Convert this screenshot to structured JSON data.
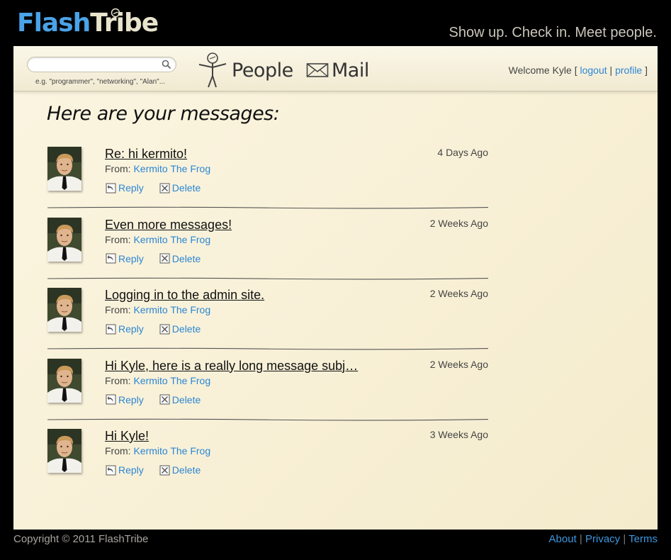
{
  "brand": {
    "logo_part1": "Flash",
    "logo_part2": "Tribe",
    "tagline": "Show up. Check in. Meet people."
  },
  "search": {
    "value": "",
    "placeholder": "",
    "hint": "e.g. \"programmer\", \"networking\", \"Alan\"..."
  },
  "nav": {
    "people_label": "People",
    "mail_label": "Mail"
  },
  "user": {
    "welcome": "Welcome Kyle",
    "open_bracket": "[",
    "logout": "logout",
    "separator": "|",
    "profile": "profile",
    "close_bracket": "]"
  },
  "main": {
    "heading": "Here are your messages:"
  },
  "messages": [
    {
      "subject": "Re: hi kermito!",
      "time": "4 Days Ago",
      "from_label": "From:",
      "sender": "Kermito The Frog",
      "reply": "Reply",
      "delete": "Delete"
    },
    {
      "subject": "Even more messages!",
      "time": "2 Weeks Ago",
      "from_label": "From:",
      "sender": "Kermito The Frog",
      "reply": "Reply",
      "delete": "Delete"
    },
    {
      "subject": "Logging in to the admin site.",
      "time": "2 Weeks Ago",
      "from_label": "From:",
      "sender": "Kermito The Frog",
      "reply": "Reply",
      "delete": "Delete"
    },
    {
      "subject": "Hi Kyle, here is a really long message subj…",
      "time": "2 Weeks Ago",
      "from_label": "From:",
      "sender": "Kermito The Frog",
      "reply": "Reply",
      "delete": "Delete"
    },
    {
      "subject": "Hi Kyle!",
      "time": "3 Weeks Ago",
      "from_label": "From:",
      "sender": "Kermito The Frog",
      "reply": "Reply",
      "delete": "Delete"
    }
  ],
  "footer": {
    "copyright": "Copyright © 2011 FlashTribe",
    "about": "About",
    "sep1": "|",
    "privacy": "Privacy",
    "sep2": "|",
    "terms": "Terms"
  },
  "colors": {
    "link": "#2b86d3",
    "logo_blue": "#4aa3e8",
    "page_bg": "#f8f0d6",
    "frame_bg": "#000000"
  },
  "icons": {
    "search": "search-icon",
    "people": "people-stick-figure-icon",
    "mail": "mail-envelope-icon",
    "reply": "reply-icon",
    "delete": "delete-icon"
  }
}
